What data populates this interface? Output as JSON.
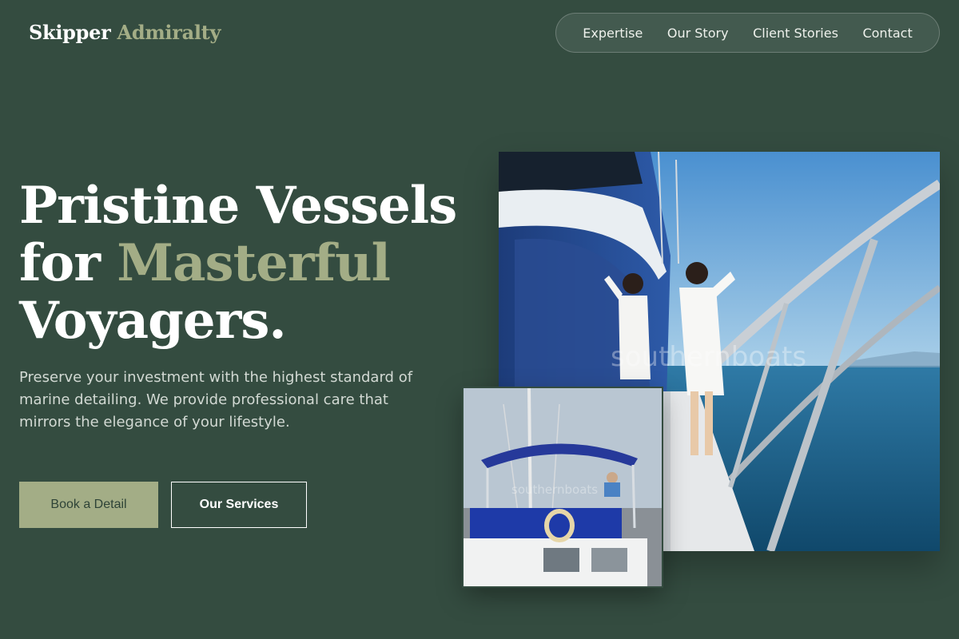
{
  "brand": {
    "part1": "Skipper",
    "part2": "Admiralty"
  },
  "nav": {
    "items": [
      "Expertise",
      "Our Story",
      "Client Stories",
      "Contact"
    ]
  },
  "hero": {
    "headline_line1": "Pristine Vessels",
    "headline_line2_prefix": "for ",
    "headline_line2_accent": "Masterful",
    "headline_line3": "Voyagers.",
    "lead": "Preserve your investment with the highest standard of marine detailing. We provide professional care that mirrors the elegance of your lifestyle.",
    "primary_cta": "Book a Detail",
    "secondary_cta": "Our Services"
  },
  "images": {
    "main_watermark": "southernboats",
    "small_watermark": "southernboats"
  },
  "colors": {
    "background": "#344c40",
    "accent": "#a3ad86",
    "text": "#ffffff"
  }
}
